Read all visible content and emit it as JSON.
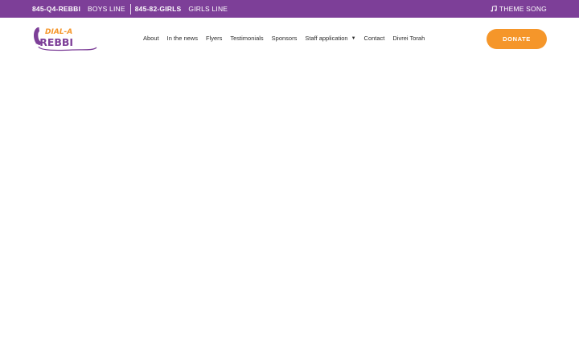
{
  "topbar": {
    "boys_phone": "845-Q4-REBBI",
    "boys_label": "BOYS LINE",
    "girls_phone": "845-82-GIRLS",
    "girls_label": "GIRLS LINE",
    "theme_song": "THEME SONG"
  },
  "logo": {
    "line1": "DIAL-A",
    "line2": "-REBBI"
  },
  "nav": {
    "items": [
      "About",
      "In the news",
      "Flyers",
      "Testimonials",
      "Sponsors",
      "Staff application",
      "Contact",
      "Divrei Torah"
    ]
  },
  "donate_label": "DONATE",
  "colors": {
    "brand_purple": "#7d3f98",
    "accent_orange": "#f5962a"
  }
}
